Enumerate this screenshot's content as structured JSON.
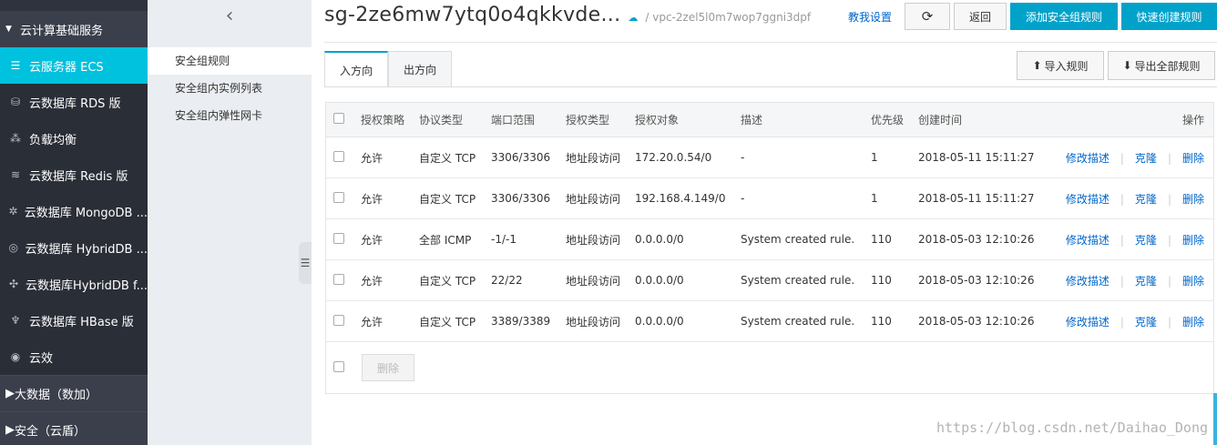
{
  "sidebar": {
    "groups": [
      {
        "label": "云计算基础服务"
      },
      {
        "label": "大数据（数加）"
      },
      {
        "label": "安全（云盾）"
      }
    ],
    "items": [
      {
        "label": "云服务器 ECS",
        "icon": "server-icon"
      },
      {
        "label": "云数据库 RDS 版",
        "icon": "database-icon"
      },
      {
        "label": "负载均衡",
        "icon": "load-balancer-icon"
      },
      {
        "label": "云数据库 Redis 版",
        "icon": "redis-icon"
      },
      {
        "label": "云数据库 MongoDB ...",
        "icon": "mongodb-icon"
      },
      {
        "label": "云数据库 HybridDB ...",
        "icon": "hybriddb-icon"
      },
      {
        "label": "云数据库HybridDB f...",
        "icon": "hybriddb-f-icon"
      },
      {
        "label": "云数据库 HBase 版",
        "icon": "hbase-icon"
      },
      {
        "label": "云效",
        "icon": "yunxiao-icon"
      }
    ]
  },
  "subnav": {
    "items": [
      "安全组规则",
      "安全组内实例列表",
      "安全组内弹性网卡"
    ]
  },
  "header": {
    "title": "sg-2ze6mw7ytq0o4qkkvde...",
    "subtitle": "/ vpc-2zel5l0m7wop7ggni3dpf",
    "tutorial": "教我设置",
    "refresh_icon": "refresh-icon",
    "back": "返回",
    "add_rule": "添加安全组规则",
    "quick_rule": "快速创建规则"
  },
  "tabs": [
    "入方向",
    "出方向"
  ],
  "tab_actions": {
    "import": "导入规则",
    "export": "导出全部规则"
  },
  "table": {
    "columns": [
      "授权策略",
      "协议类型",
      "端口范围",
      "授权类型",
      "授权对象",
      "描述",
      "优先级",
      "创建时间",
      "操作"
    ],
    "rows": [
      {
        "policy": "允许",
        "protocol": "自定义 TCP",
        "port": "3306/3306",
        "auth_type": "地址段访问",
        "object": "172.20.0.54/0",
        "desc": "-",
        "priority": "1",
        "time": "2018-05-11 15:11:27"
      },
      {
        "policy": "允许",
        "protocol": "自定义 TCP",
        "port": "3306/3306",
        "auth_type": "地址段访问",
        "object": "192.168.4.149/0",
        "desc": "-",
        "priority": "1",
        "time": "2018-05-11 15:11:27"
      },
      {
        "policy": "允许",
        "protocol": "全部 ICMP",
        "port": "-1/-1",
        "auth_type": "地址段访问",
        "object": "0.0.0.0/0",
        "desc": "System created rule.",
        "priority": "110",
        "time": "2018-05-03 12:10:26"
      },
      {
        "policy": "允许",
        "protocol": "自定义 TCP",
        "port": "22/22",
        "auth_type": "地址段访问",
        "object": "0.0.0.0/0",
        "desc": "System created rule.",
        "priority": "110",
        "time": "2018-05-03 12:10:26"
      },
      {
        "policy": "允许",
        "protocol": "自定义 TCP",
        "port": "3389/3389",
        "auth_type": "地址段访问",
        "object": "0.0.0.0/0",
        "desc": "System created rule.",
        "priority": "110",
        "time": "2018-05-03 12:10:26"
      }
    ],
    "ops": {
      "edit": "修改描述",
      "clone": "克隆",
      "delete": "删除"
    },
    "footer_delete": "删除"
  },
  "watermark": "https://blog.csdn.net/Daihao_Dong",
  "colors": {
    "accent": "#00a2ca",
    "sidebar_active": "#00c1de",
    "link": "#0066cc"
  }
}
